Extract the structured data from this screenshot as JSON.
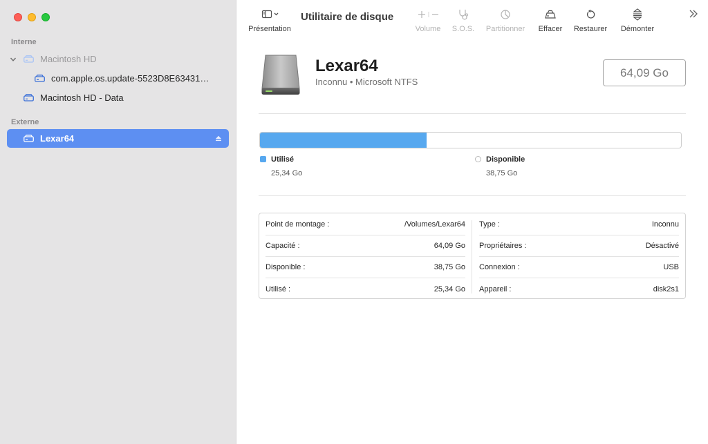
{
  "window": {
    "app_title": "Utilitaire de disque"
  },
  "toolbar": {
    "presentation": "Présentation",
    "volume": "Volume",
    "sos": "S.O.S.",
    "partition": "Partitionner",
    "erase": "Effacer",
    "restore": "Restaurer",
    "unmount": "Démonter"
  },
  "sidebar": {
    "internal_label": "Interne",
    "external_label": "Externe",
    "items": [
      {
        "label": "Macintosh HD"
      },
      {
        "label": "com.apple.os.update-5523D8E63431…"
      },
      {
        "label": "Macintosh HD - Data"
      },
      {
        "label": "Lexar64"
      }
    ]
  },
  "volume": {
    "name": "Lexar64",
    "subtitle": "Inconnu • Microsoft NTFS",
    "size": "64,09 Go"
  },
  "usage": {
    "used_fraction": 0.3954,
    "used_label": "Utilisé",
    "used_value": "25,34 Go",
    "free_label": "Disponible",
    "free_value": "38,75 Go"
  },
  "info": {
    "left": [
      {
        "label": "Point de montage :",
        "value": "/Volumes/Lexar64"
      },
      {
        "label": "Capacité :",
        "value": "64,09 Go"
      },
      {
        "label": "Disponible :",
        "value": "38,75 Go"
      },
      {
        "label": "Utilisé :",
        "value": "25,34 Go"
      }
    ],
    "right": [
      {
        "label": "Type :",
        "value": "Inconnu"
      },
      {
        "label": "Propriétaires :",
        "value": "Désactivé"
      },
      {
        "label": "Connexion :",
        "value": "USB"
      },
      {
        "label": "Appareil :",
        "value": "disk2s1"
      }
    ]
  },
  "colors": {
    "accent": "#5d8ff2",
    "used": "#57a8ef"
  }
}
